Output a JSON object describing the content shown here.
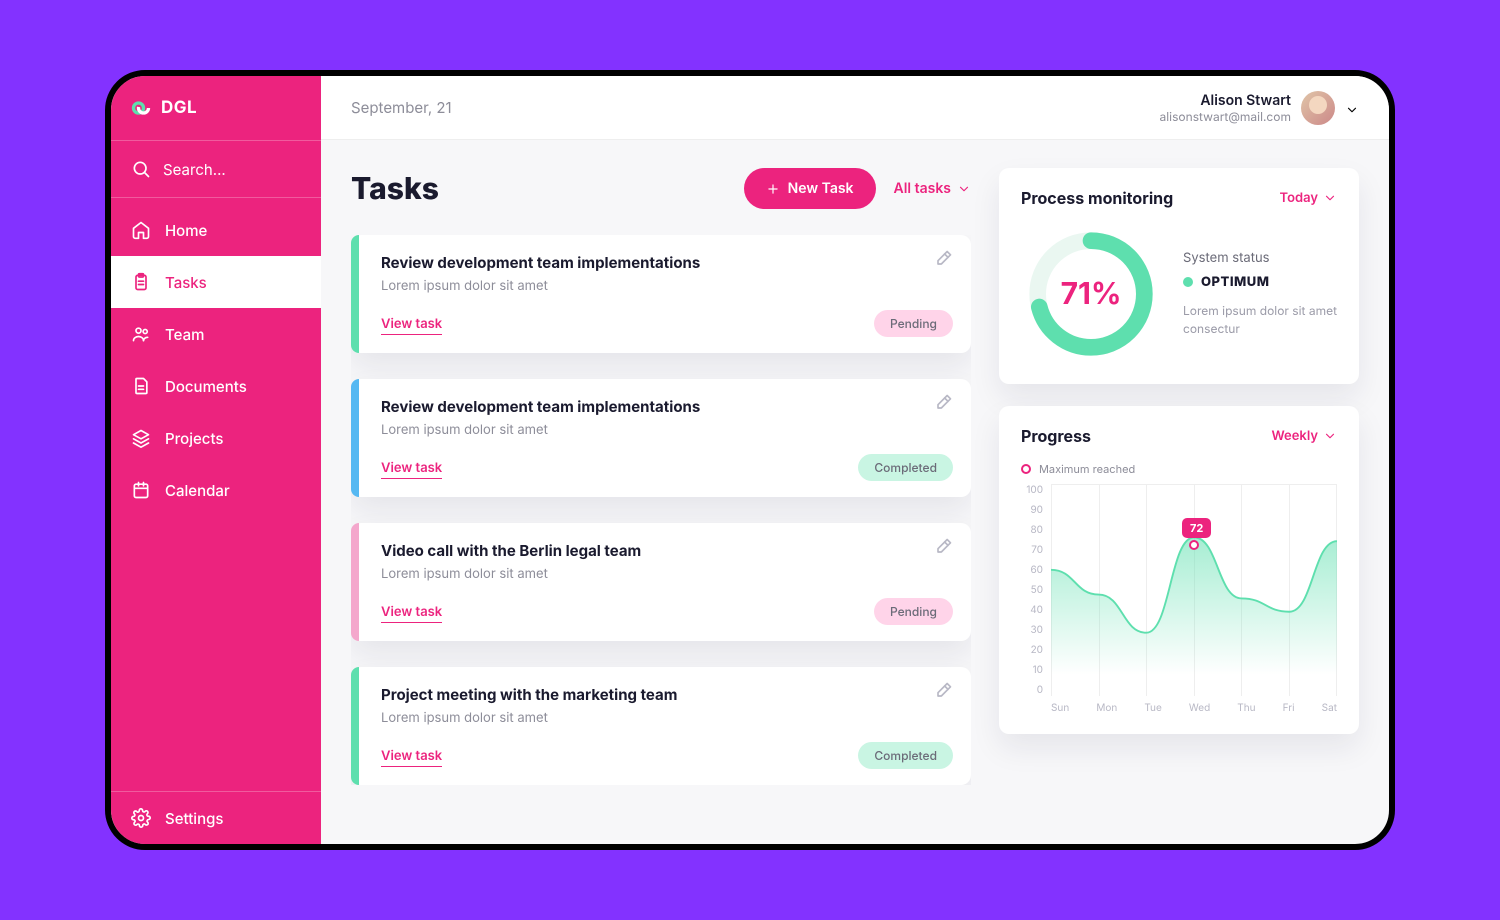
{
  "brand": {
    "name": "DGL"
  },
  "search": {
    "placeholder": "Search..."
  },
  "nav": {
    "items": [
      {
        "label": "Home"
      },
      {
        "label": "Tasks"
      },
      {
        "label": "Team"
      },
      {
        "label": "Documents"
      },
      {
        "label": "Projects"
      },
      {
        "label": "Calendar"
      }
    ],
    "settings": "Settings"
  },
  "topbar": {
    "date": "September, 21",
    "user_name": "Alison Stwart",
    "user_mail": "alisonstwart@mail.com"
  },
  "tasks": {
    "title": "Tasks",
    "new_label": "New Task",
    "filter": "All tasks",
    "view_label": "View task",
    "items": [
      {
        "title": "Review development team implementations",
        "sub": "Lorem ipsum dolor sit amet",
        "status": "Pending",
        "stripe": "green"
      },
      {
        "title": "Review development team implementations",
        "sub": "Lorem ipsum dolor sit amet",
        "status": "Completed",
        "stripe": "blue"
      },
      {
        "title": "Video call with the Berlin legal team",
        "sub": "Lorem ipsum dolor sit amet",
        "status": "Pending",
        "stripe": "pink"
      },
      {
        "title": "Project meeting with the marketing team",
        "sub": "Lorem ipsum dolor sit amet",
        "status": "Completed",
        "stripe": "green"
      }
    ]
  },
  "process": {
    "title": "Process monitoring",
    "filter": "Today",
    "percent_label": "71%",
    "percent": 71,
    "status_label": "System status",
    "status_value": "OPTIMUM",
    "status_desc": "Lorem ipsum dolor sit amet consectur"
  },
  "progress": {
    "title": "Progress",
    "filter": "Weekly",
    "legend": "Maximum reached",
    "peak_label": "72"
  },
  "chart_data": {
    "type": "area",
    "categories": [
      "Sun",
      "Mon",
      "Tue",
      "Wed",
      "Thu",
      "Fri",
      "Sat"
    ],
    "values": [
      55,
      42,
      22,
      72,
      40,
      33,
      70
    ],
    "ylim": [
      0,
      100
    ],
    "yticks": [
      100,
      90,
      80,
      70,
      60,
      50,
      40,
      30,
      20,
      10,
      0
    ],
    "peak": {
      "x_index": 3,
      "value": 72
    }
  },
  "colors": {
    "accent": "#ec237e",
    "green": "#5edfae",
    "blue": "#55b8f2",
    "pink": "#f4a7cc"
  }
}
